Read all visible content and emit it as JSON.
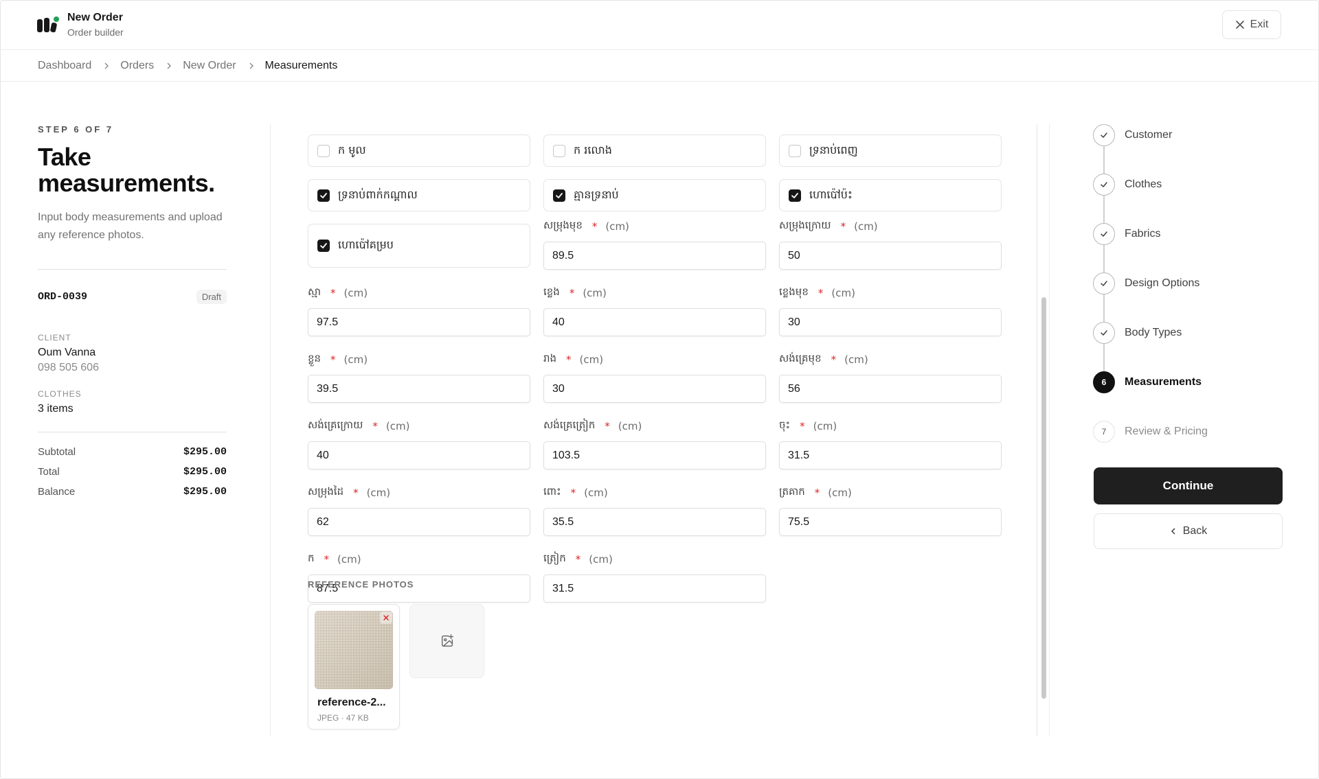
{
  "header": {
    "title": "New Order",
    "subtitle": "Order builder",
    "exit_label": "Exit"
  },
  "breadcrumb": [
    "Dashboard",
    "Orders",
    "New Order",
    "Measurements"
  ],
  "summary": {
    "step_label": "STEP 6 OF 7",
    "title": "Take measurements.",
    "description": "Input body measurements and upload any reference photos.",
    "order_id": "ORD-0039",
    "status": "Draft",
    "client_label": "CLIENT",
    "client_name": "Oum Vanna",
    "client_phone": "098 505 606",
    "clothes_label": "CLOTHES",
    "clothes_value": "3 items",
    "subtotal_label": "Subtotal",
    "subtotal": "$295.00",
    "total_label": "Total",
    "total": "$295.00",
    "balance_label": "Balance",
    "balance": "$295.00"
  },
  "options": [
    {
      "label": "ក មូល",
      "checked": false
    },
    {
      "label": "ក រលោង",
      "checked": false
    },
    {
      "label": "ទ្រនាប់ពេញ",
      "checked": false
    },
    {
      "label": "ទ្រនាប់ពាក់កណ្ដាល",
      "checked": true
    },
    {
      "label": "គ្មានទ្រនាប់",
      "checked": true
    },
    {
      "label": "ហោប៉ៅប៉ះ",
      "checked": true
    },
    {
      "label": "ហោប៉ៅគម្រប",
      "checked": true
    }
  ],
  "unit_label": "(cm)",
  "required_mark": "*",
  "measurements": [
    {
      "label": "សម្រុងមុខ",
      "value": "89.5"
    },
    {
      "label": "សម្រុងក្រោយ",
      "value": "50"
    },
    {
      "label": "ស្មា",
      "value": "97.5"
    },
    {
      "label": "ខ្លេង",
      "value": "40"
    },
    {
      "label": "ខ្លេងមុខ",
      "value": "30"
    },
    {
      "label": "ខ្លួន",
      "value": "39.5"
    },
    {
      "label": "រាង",
      "value": "30"
    },
    {
      "label": "សង់គ្រេមុខ",
      "value": "56"
    },
    {
      "label": "សង់គ្រេក្រោយ",
      "value": "40"
    },
    {
      "label": "សង់គ្រេត្រៀក",
      "value": "103.5"
    },
    {
      "label": "ចុះ",
      "value": "31.5"
    },
    {
      "label": "សម្រុងដៃ",
      "value": "62"
    },
    {
      "label": "ពោះ",
      "value": "35.5"
    },
    {
      "label": "ត្រគាក",
      "value": "75.5"
    },
    {
      "label": "ក",
      "value": "87.5"
    },
    {
      "label": "ត្រៀក",
      "value": "31.5"
    }
  ],
  "reference_photos": {
    "label": "REFERENCE PHOTOS",
    "items": [
      {
        "name": "reference-2...",
        "meta": "JPEG · 47 KB"
      }
    ]
  },
  "stepper": {
    "steps": [
      {
        "name": "Customer",
        "state": "done",
        "number": "1"
      },
      {
        "name": "Clothes",
        "state": "done",
        "number": "2"
      },
      {
        "name": "Fabrics",
        "state": "done",
        "number": "3"
      },
      {
        "name": "Design Options",
        "state": "done",
        "number": "4"
      },
      {
        "name": "Body Types",
        "state": "done",
        "number": "5"
      },
      {
        "name": "Measurements",
        "state": "active",
        "number": "6"
      },
      {
        "name": "Review & Pricing",
        "state": "upcoming",
        "number": "7"
      }
    ],
    "continue_label": "Continue",
    "back_label": "Back"
  }
}
